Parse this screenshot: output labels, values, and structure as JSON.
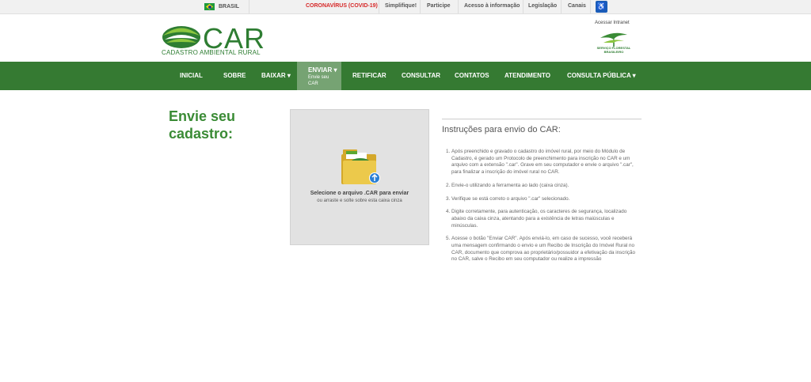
{
  "gov_bar": {
    "country": "BRASIL",
    "links": [
      "CORONAVÍRUS (COVID-19)",
      "Simplifique!",
      "Participe",
      "Acesso à informação",
      "Legislação",
      "Canais"
    ]
  },
  "header": {
    "logo_text": "CAR",
    "logo_subtitle": "CADASTRO AMBIENTAL RURAL",
    "intranet_label": "Acessar Intranet",
    "sfb_label_1": "SERVIÇO FLORESTAL",
    "sfb_label_2": "BRASILEIRO"
  },
  "nav": {
    "items": [
      "INICIAL",
      "SOBRE",
      "BAIXAR ▾",
      "ENVIAR ▾",
      "RETIFICAR",
      "CONSULTAR",
      "CONTATOS",
      "ATENDIMENTO",
      "CONSULTA PÚBLICA ▾"
    ],
    "active_sub_1": "Envie seu",
    "active_sub_2": "CAR"
  },
  "main": {
    "title": "Envie seu cadastro:",
    "dropbox": {
      "text": "Selecione o arquivo .CAR para enviar",
      "hint": "ou arraste e solte sobre esta caixa cinza"
    },
    "instructions": {
      "heading": "Instruções para envio do CAR:",
      "steps": [
        "Após preenchido e gravado o cadastro do imóvel rural, por meio do Módulo de Cadastro, é gerado um Protocolo de preenchimento para inscrição no CAR e um arquivo com a extensão \".car\". Grave em seu computador e envie o arquivo \".car\", para finalizar a inscrição do imóvel rural no CAR.",
        "Envie-o utilizando a ferramenta ao lado (caixa cinza).",
        "Verifique se está correto o arquivo \".car\" selecionado.",
        "Digite corretamente, para autenticação, os caracteres de segurança, localizado abaixo da caixa cinza, atentando para a existência de letras maiúsculas e minúsculas.",
        "Acesse o botão \"Enviar CAR\". Após enviá-lo, em caso de sucesso, você receberá uma mensagem confirmando o envio e um Recibo de Inscrição do Imóvel Rural no CAR, documento que comprova ao proprietário/possuidor a efetivação da inscrição no CAR, salve o Recibo em seu computador ou realize a impressão"
      ]
    }
  },
  "colors": {
    "nav_green": "#357a32",
    "nav_active": "#76a373",
    "title_green": "#3a8b35",
    "covid_red": "#d62828"
  }
}
